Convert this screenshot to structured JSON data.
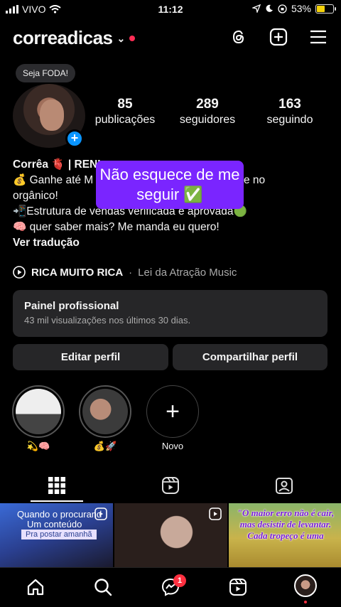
{
  "status_bar": {
    "carrier": "VIVO",
    "time": "11:12",
    "battery": "53%",
    "battery_level": 0.53
  },
  "header": {
    "username": "correadicas"
  },
  "profile": {
    "note": "Seja FODA!",
    "stats": [
      {
        "value": "85",
        "label": "publicações"
      },
      {
        "value": "289",
        "label": "seguidores"
      },
      {
        "value": "163",
        "label": "seguindo"
      }
    ],
    "bio": {
      "name": "Corrêa 🫀 | RENI",
      "line1_prefix": "💰 Ganhe até M",
      "line1_suffix": "totalmente no",
      "line2": "orgânico!",
      "line3": "📲Estrutura de vendas verificada e aprovada🟢",
      "line4": "🧠 quer saber mais? Me manda eu quero!",
      "translate": "Ver tradução"
    },
    "overlay_text": "Não esquece de me seguir ✅"
  },
  "music": {
    "title": "RICA MUITO RICA",
    "separator": "·",
    "artist": "Lei da Atração Music"
  },
  "panel": {
    "title": "Painel profissional",
    "subtitle": "43 mil visualizações nos últimos 30 dias."
  },
  "actions": {
    "edit": "Editar perfil",
    "share": "Compartilhar perfil"
  },
  "highlights": [
    {
      "caption": "💫🧠"
    },
    {
      "caption": "💰🚀"
    },
    {
      "caption": "Novo"
    }
  ],
  "grid": {
    "post1": {
      "line1": "Quando o procurand",
      "line2": "Um conteúdo",
      "pill": "Pra postar amanhã"
    },
    "post3": {
      "quote": "\"O maior erro não é cair, mas desistir de levantar. Cada tropeço é uma"
    }
  },
  "bottom_nav": {
    "messages_badge": "1"
  },
  "colors": {
    "accent_blue": "#0a95ff",
    "overlay_purple": "#7a25ff",
    "notification_red": "#ff3040",
    "surface": "#262628"
  }
}
